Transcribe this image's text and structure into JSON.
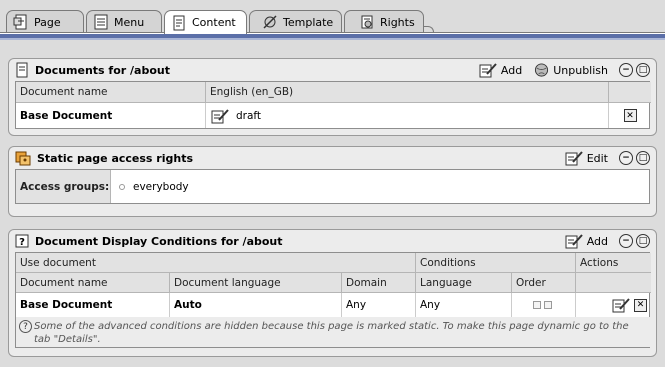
{
  "tabs": [
    {
      "label": "Page",
      "icon": "page-icon"
    },
    {
      "label": "Menu",
      "icon": "menu-icon"
    },
    {
      "label": "Content",
      "icon": "content-icon"
    },
    {
      "label": "Template",
      "icon": "template-icon"
    },
    {
      "label": "Rights",
      "icon": "rights-icon"
    }
  ],
  "documents": {
    "title": "Documents for /about",
    "add_label": "Add",
    "unpublish_label": "Unpublish",
    "col_name": "Document name",
    "col_lang": "English (en_GB)",
    "row_name": "Base Document",
    "row_status": "draft"
  },
  "access": {
    "title": "Static page access rights",
    "edit_label": "Edit",
    "groups_label": "Access groups:",
    "groups_value": "everybody"
  },
  "conditions": {
    "title": "Document Display Conditions for /about",
    "add_label": "Add",
    "group_use": "Use document",
    "group_conditions": "Conditions",
    "group_actions": "Actions",
    "col_docname": "Document name",
    "col_doclang": "Document language",
    "col_domain": "Domain",
    "col_language": "Language",
    "col_order": "Order",
    "row_docname": "Base Document",
    "row_doclang": "Auto",
    "row_domain": "Any",
    "row_language": "Any",
    "note": "Some of the advanced conditions are hidden because this page is marked static. To make this page dynamic go to the tab \"Details\"."
  },
  "colors": {
    "accent_bar": "#5b6fa8",
    "panel_bg": "#ececec"
  }
}
